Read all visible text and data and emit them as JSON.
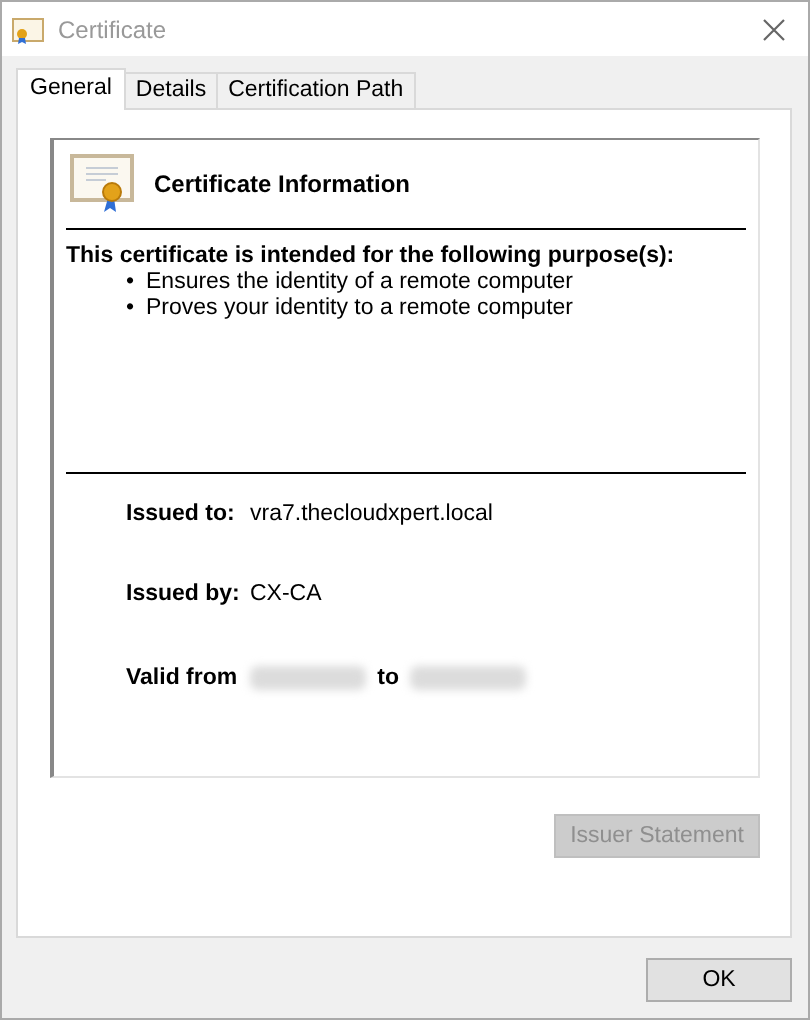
{
  "window": {
    "title": "Certificate"
  },
  "tabs": [
    {
      "label": "General",
      "selected": true
    },
    {
      "label": "Details",
      "selected": false
    },
    {
      "label": "Certification Path",
      "selected": false
    }
  ],
  "heading": "Certificate Information",
  "purpose_title": "This certificate is intended for the following purpose(s):",
  "purposes": [
    "Ensures the identity of a remote computer",
    "Proves your identity to a remote computer"
  ],
  "bullet": "•",
  "fields": [
    {
      "label": "Issued to:",
      "value": "vra7.thecloudxpert.local"
    },
    {
      "label": "Issued by:",
      "value": "CX-CA"
    }
  ],
  "valid": {
    "label": "Valid from",
    "to": "to"
  },
  "issuer_button": {
    "label": "Issuer Statement",
    "disabled": true
  },
  "ok_button": {
    "label": "OK",
    "disabled": false
  }
}
